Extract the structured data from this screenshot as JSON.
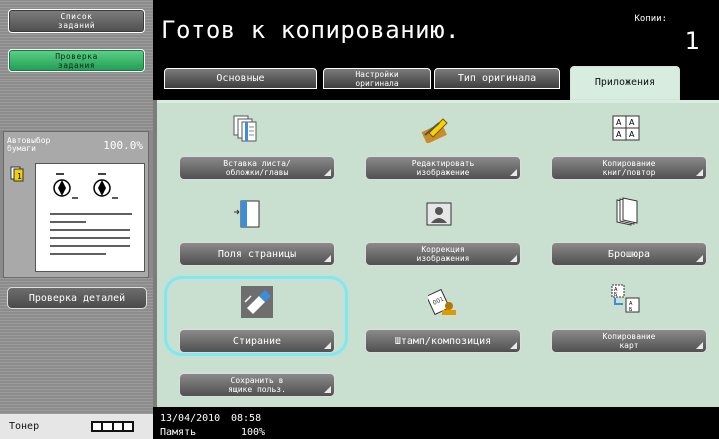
{
  "left": {
    "job_list": "Список\nзаданий",
    "check_job": "Проверка\nзадания",
    "paper_label": "Автовыбор\nбумаги",
    "zoom": "100.0%",
    "details": "Проверка деталей",
    "toner_label": "Тонер"
  },
  "header": {
    "title": "Готов к копированию.",
    "copies_label": "Копии:",
    "copies_value": "1"
  },
  "tabs": [
    {
      "label": "Основные"
    },
    {
      "label": "Настройки\nоригинала"
    },
    {
      "label": "Тип оригинала"
    },
    {
      "label": "Приложения",
      "active": true
    }
  ],
  "functions": {
    "insert_sheet": "Вставка листа/\nобложки/главы",
    "edit_image": "Редактировать\nизображение",
    "book_copy": "Копирование\nкниг/повтор",
    "page_margin": "Поля страницы",
    "image_adjust": "Коррекция\nизображения",
    "booklet": "Брошюра",
    "erase": "Стирание",
    "stamp": "Штамп/композиция",
    "card_copy": "Копирование\nкарт",
    "save_box": "Сохранить в\nящике польз."
  },
  "status": {
    "date": "13/04/2010",
    "time": "08:58",
    "memory_label": "Память",
    "memory_value": "100%"
  },
  "colors": {
    "panel": "#c9dfd0",
    "active_tab": "#d8ecdf",
    "highlight": "#7ce9f3",
    "accent_green": "#2faf63"
  }
}
